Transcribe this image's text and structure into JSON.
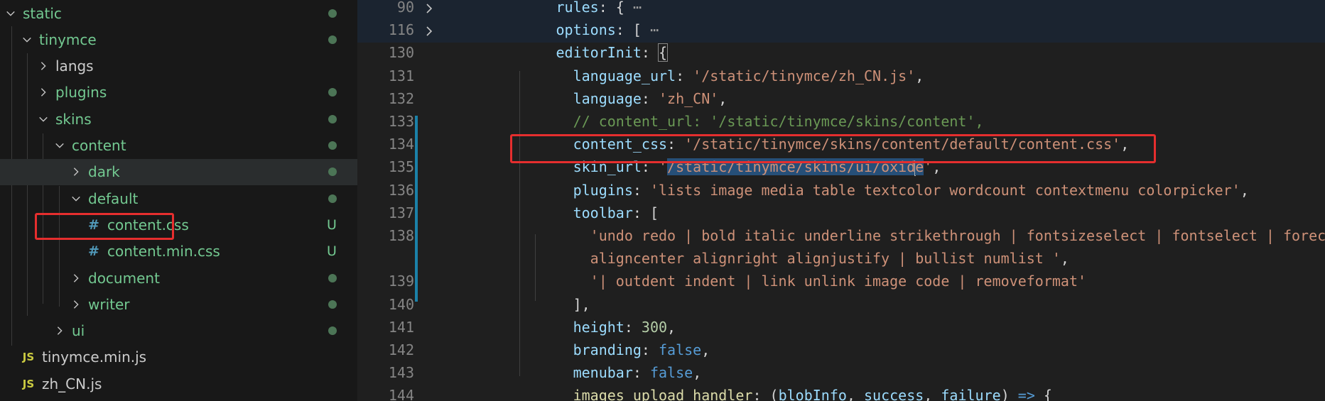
{
  "explorer": {
    "items": [
      {
        "label": "static",
        "type": "folder",
        "expanded": true,
        "depth": 0,
        "color": "green",
        "status": "dot"
      },
      {
        "label": "tinymce",
        "type": "folder",
        "expanded": true,
        "depth": 1,
        "color": "green",
        "status": "dot"
      },
      {
        "label": "langs",
        "type": "folder",
        "expanded": false,
        "depth": 2,
        "color": "white",
        "status": ""
      },
      {
        "label": "plugins",
        "type": "folder",
        "expanded": false,
        "depth": 2,
        "color": "green",
        "status": "dot"
      },
      {
        "label": "skins",
        "type": "folder",
        "expanded": true,
        "depth": 2,
        "color": "green",
        "status": "dot"
      },
      {
        "label": "content",
        "type": "folder",
        "expanded": true,
        "depth": 3,
        "color": "green",
        "status": "dot"
      },
      {
        "label": "dark",
        "type": "folder",
        "expanded": false,
        "depth": 4,
        "color": "green",
        "status": "dot"
      },
      {
        "label": "default",
        "type": "folder",
        "expanded": true,
        "depth": 4,
        "color": "green",
        "status": "dot"
      },
      {
        "label": "content.css",
        "type": "css",
        "depth": 5,
        "color": "green",
        "status": "U"
      },
      {
        "label": "content.min.css",
        "type": "css",
        "depth": 5,
        "color": "green",
        "status": "U"
      },
      {
        "label": "document",
        "type": "folder",
        "expanded": false,
        "depth": 4,
        "color": "green",
        "status": "dot"
      },
      {
        "label": "writer",
        "type": "folder",
        "expanded": false,
        "depth": 4,
        "color": "green",
        "status": "dot"
      },
      {
        "label": "ui",
        "type": "folder",
        "expanded": false,
        "depth": 3,
        "color": "green",
        "status": "dot"
      },
      {
        "label": "tinymce.min.js",
        "type": "js",
        "depth": 1,
        "color": "white",
        "status": ""
      },
      {
        "label": "zh_CN.js",
        "type": "js",
        "depth": 1,
        "color": "white",
        "status": ""
      }
    ],
    "js_badge": "JS",
    "css_badge": "#"
  },
  "editor": {
    "lines": [
      {
        "num": "90",
        "fold": true,
        "tokens": [
          [
            "            ",
            "p"
          ],
          [
            "rules",
            "prop"
          ],
          [
            ": {",
            "p"
          ],
          [
            " ⋯",
            "e"
          ]
        ]
      },
      {
        "num": "116",
        "fold": true,
        "tokens": [
          [
            "            ",
            "p"
          ],
          [
            "options",
            "prop"
          ],
          [
            ": [",
            "p"
          ],
          [
            " ⋯",
            "e"
          ]
        ]
      },
      {
        "num": "130",
        "tokens": [
          [
            "            ",
            "p"
          ],
          [
            "editorInit",
            "prop"
          ],
          [
            ": ",
            "p"
          ],
          [
            "{",
            "bm"
          ]
        ]
      },
      {
        "num": "131",
        "tokens": [
          [
            "              ",
            "p"
          ],
          [
            "language_url",
            "prop"
          ],
          [
            ": ",
            "p"
          ],
          [
            "'/static/tinymce/zh_CN.js'",
            "s"
          ],
          [
            ",",
            "p"
          ]
        ]
      },
      {
        "num": "132",
        "tokens": [
          [
            "              ",
            "p"
          ],
          [
            "language",
            "prop"
          ],
          [
            ": ",
            "p"
          ],
          [
            "'zh_CN'",
            "s"
          ],
          [
            ",",
            "p"
          ]
        ]
      },
      {
        "num": "133",
        "tokens": [
          [
            "              ",
            "p"
          ],
          [
            "// content_url: '/static/tinymce/skins/content',",
            "c"
          ]
        ]
      },
      {
        "num": "134",
        "tokens": [
          [
            "              ",
            "p"
          ],
          [
            "content_css",
            "prop"
          ],
          [
            ": ",
            "p"
          ],
          [
            "'/static/tinymce/skins/content/default/content.css'",
            "s"
          ],
          [
            ",",
            "p"
          ]
        ]
      },
      {
        "num": "135",
        "tokens": [
          [
            "              ",
            "p"
          ],
          [
            "skin_url",
            "prop"
          ],
          [
            ": ",
            "p"
          ],
          [
            "'",
            "s"
          ],
          [
            "/static/tinymce/skins/ui/oxid",
            "sel"
          ],
          [
            "|",
            "cur"
          ],
          [
            "e",
            "sel"
          ],
          [
            "'",
            "s"
          ],
          [
            ",",
            "p"
          ]
        ]
      },
      {
        "num": "136",
        "tokens": [
          [
            "              ",
            "p"
          ],
          [
            "plugins",
            "prop"
          ],
          [
            ": ",
            "p"
          ],
          [
            "'lists image media table textcolor wordcount contextmenu colorpicker'",
            "s"
          ],
          [
            ",",
            "p"
          ]
        ]
      },
      {
        "num": "137",
        "tokens": [
          [
            "              ",
            "p"
          ],
          [
            "toolbar",
            "prop"
          ],
          [
            ": [",
            "p"
          ]
        ]
      },
      {
        "num": "138",
        "tokens": [
          [
            "                ",
            "p"
          ],
          [
            "'undo redo | bold italic underline strikethrough | fontsizeselect | fontselect | forecolor backcolor | alignleft",
            "s"
          ]
        ]
      },
      {
        "num": "",
        "tokens": [
          [
            "                ",
            "p"
          ],
          [
            "aligncenter alignright alignjustify | bullist numlist '",
            "s"
          ],
          [
            ",",
            "p"
          ]
        ]
      },
      {
        "num": "139",
        "tokens": [
          [
            "                ",
            "p"
          ],
          [
            "'| outdent indent | link unlink image code | removeformat'",
            "s"
          ]
        ]
      },
      {
        "num": "140",
        "tokens": [
          [
            "              ",
            "p"
          ],
          [
            "],",
            "p"
          ]
        ]
      },
      {
        "num": "141",
        "tokens": [
          [
            "              ",
            "p"
          ],
          [
            "height",
            "prop"
          ],
          [
            ": ",
            "p"
          ],
          [
            "300",
            "n"
          ],
          [
            ",",
            "p"
          ]
        ]
      },
      {
        "num": "142",
        "tokens": [
          [
            "              ",
            "p"
          ],
          [
            "branding",
            "prop"
          ],
          [
            ": ",
            "p"
          ],
          [
            "false",
            "k"
          ],
          [
            ",",
            "p"
          ]
        ]
      },
      {
        "num": "143",
        "tokens": [
          [
            "              ",
            "p"
          ],
          [
            "menubar",
            "prop"
          ],
          [
            ": ",
            "p"
          ],
          [
            "false",
            "k"
          ],
          [
            ",",
            "p"
          ]
        ]
      },
      {
        "num": "144",
        "tokens": [
          [
            "              ",
            "p"
          ],
          [
            "images_upload_handler",
            "fn"
          ],
          [
            ": (",
            "p"
          ],
          [
            "blobInfo",
            "prop"
          ],
          [
            ", ",
            "p"
          ],
          [
            "success",
            "prop"
          ],
          [
            ", ",
            "p"
          ],
          [
            "failure",
            "prop"
          ],
          [
            ") ",
            "p"
          ],
          [
            "=>",
            "k"
          ],
          [
            " {",
            "p"
          ]
        ]
      }
    ]
  },
  "colors": {
    "highlight": "#e52e2e",
    "gutter_modified": "#1b81a8",
    "git_untracked": "#73c991"
  }
}
